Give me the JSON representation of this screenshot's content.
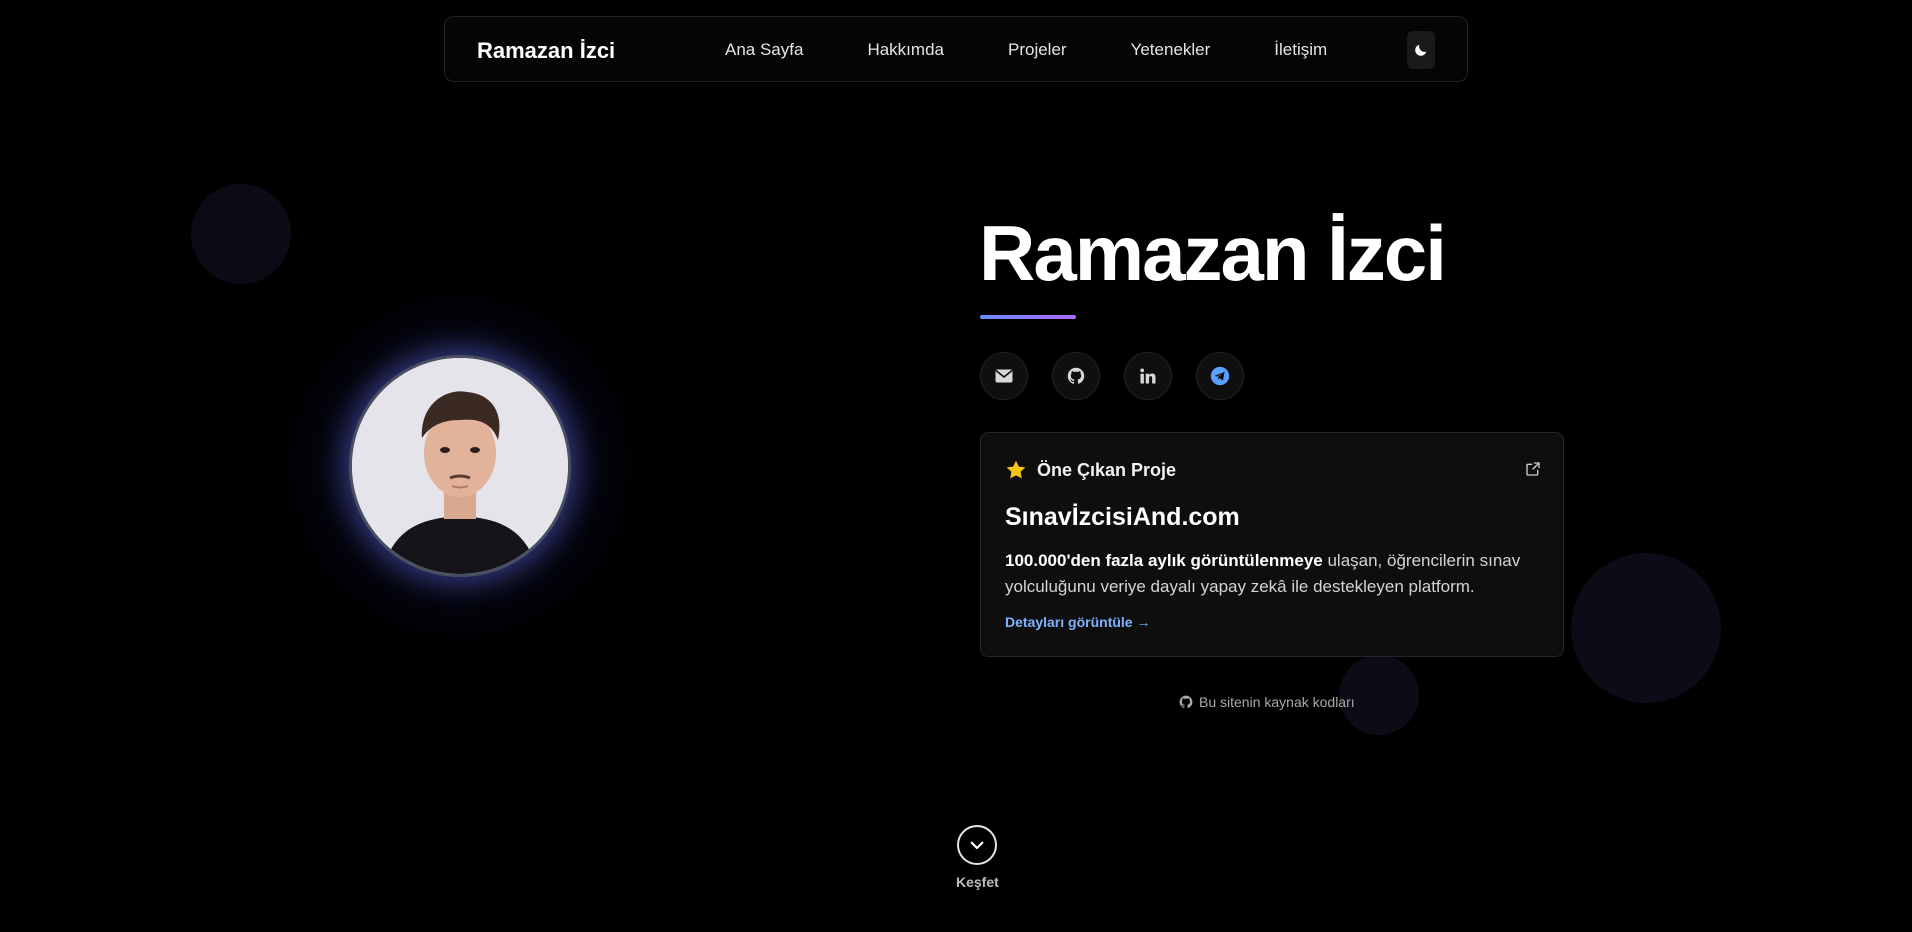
{
  "nav": {
    "brand": "Ramazan İzci",
    "links": [
      "Ana Sayfa",
      "Hakkımda",
      "Projeler",
      "Yetenekler",
      "İletişim"
    ],
    "theme_icon": "moon-icon"
  },
  "hero": {
    "name": "Ramazan İzci",
    "underline_colors": [
      "#6b8cff",
      "#b06bff"
    ],
    "socials": [
      {
        "name": "email",
        "icon": "envelope-icon"
      },
      {
        "name": "github",
        "icon": "github-icon"
      },
      {
        "name": "linkedin",
        "icon": "linkedin-icon"
      },
      {
        "name": "telegram",
        "icon": "telegram-icon"
      }
    ]
  },
  "featured": {
    "label": "Öne Çıkan Proje",
    "title": "SınavİzcisiAnd.com",
    "desc_bold": "100.000'den fazla aylık görüntülenmeye",
    "desc_rest": " ulaşan, öğrencilerin sınav yolculuğunu veriye dayalı yapay zekâ ile destekleyen platform.",
    "link": "Detayları görüntüle →"
  },
  "source_link": "Bu sitenin kaynak kodları",
  "explore": {
    "label": "Keşfet"
  },
  "colors": {
    "background": "#000000",
    "accent_link": "#7fb2ff",
    "star": "#f5c518",
    "telegram": "#5aa0ff"
  }
}
